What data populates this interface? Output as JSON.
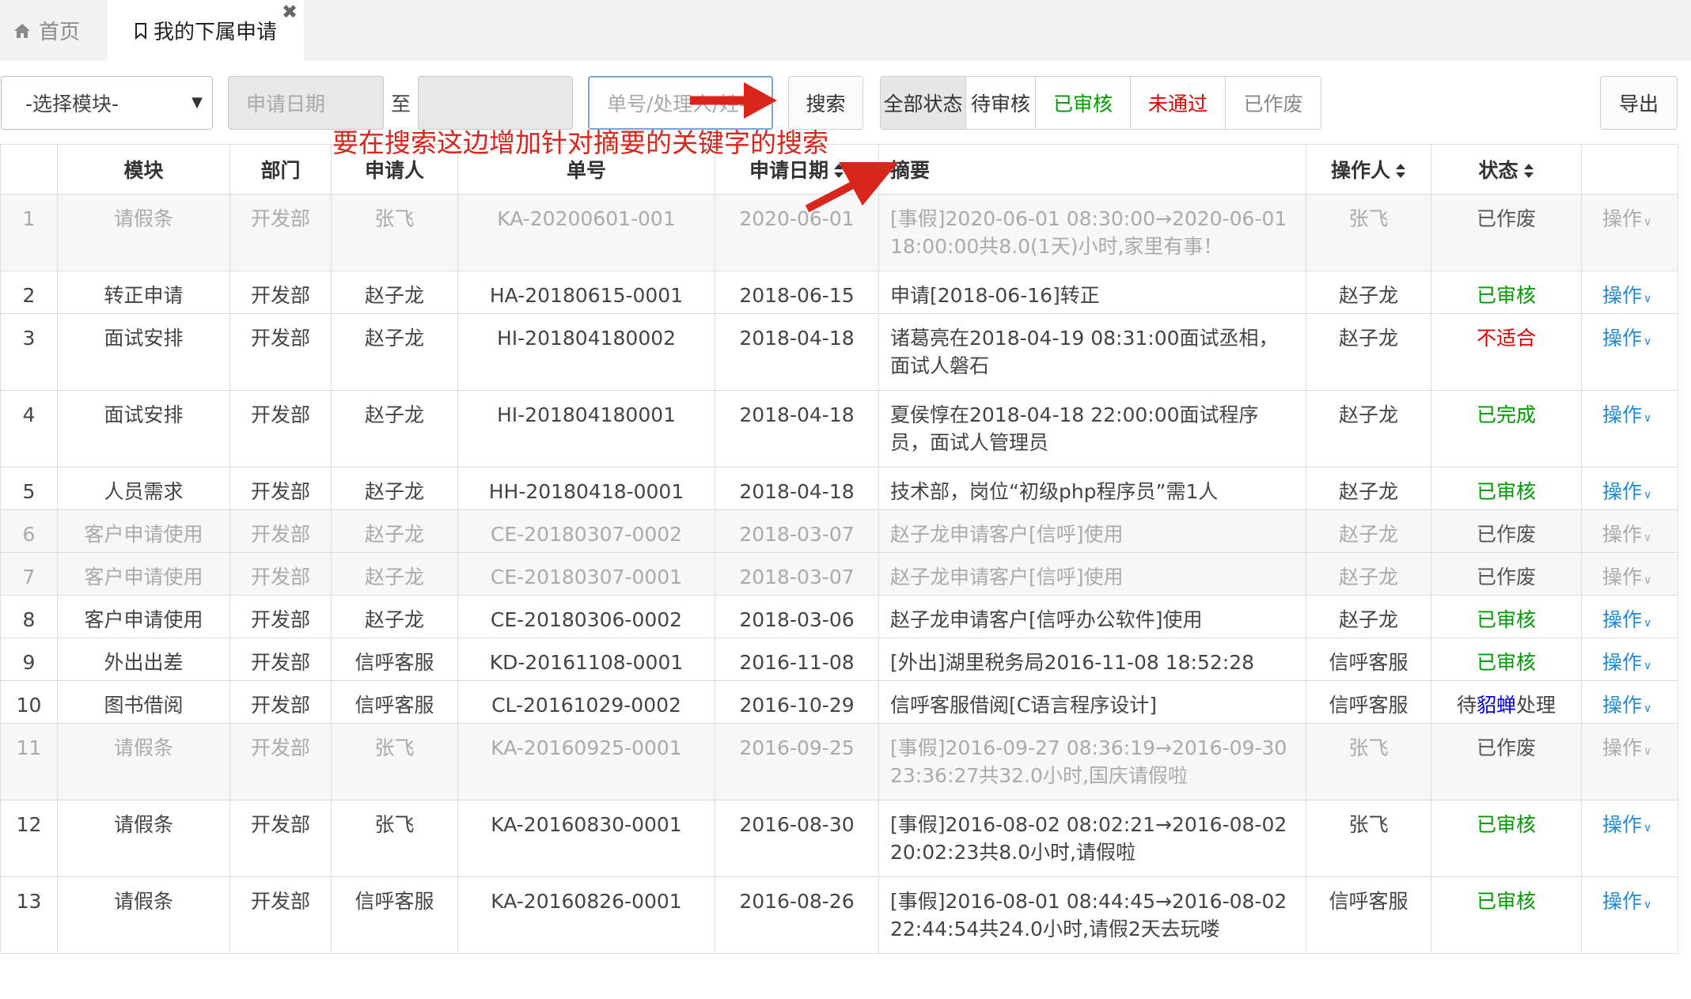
{
  "tabs": {
    "home_label": "首页",
    "active_label": "我的下属申请",
    "close_glyph": "✖"
  },
  "toolbar": {
    "module_select": "-选择模块-",
    "date_placeholder": "申请日期",
    "to_label": "至",
    "search_placeholder": "单号/处理人/姓名",
    "search_label": "搜索",
    "export_label": "导出",
    "status_filters": [
      {
        "label": "全部状态",
        "color": "#333333",
        "active": true
      },
      {
        "label": "待审核",
        "color": "#333333",
        "active": false
      },
      {
        "label": "已审核",
        "color": "#009900",
        "active": false
      },
      {
        "label": "未通过",
        "color": "#e00000",
        "active": false
      },
      {
        "label": "已作废",
        "color": "#888888",
        "active": false
      }
    ]
  },
  "annotation": {
    "text": "要在搜索这边增加针对摘要的关键字的搜索",
    "color": "#d9261c"
  },
  "table": {
    "headers": {
      "num": "",
      "module": "模块",
      "dept": "部门",
      "applicant": "申请人",
      "number": "单号",
      "date": "申请日期",
      "summary": "摘要",
      "operator": "操作人",
      "status": "状态",
      "op": ""
    },
    "action_label": "操作",
    "rows": [
      {
        "num": "1",
        "module": "请假条",
        "dept": "开发部",
        "applicant": "张飞",
        "number": "KA-20200601-001",
        "date": "2020-06-01",
        "summary": "[事假]2020-06-01 08:30:00→2020-06-01 18:00:00共8.0(1天)小时,家里有事！",
        "operator": "张飞",
        "status": "已作废",
        "status_color": "#555555",
        "dim": true
      },
      {
        "num": "2",
        "module": "转正申请",
        "dept": "开发部",
        "applicant": "赵子龙",
        "number": "HA-20180615-0001",
        "date": "2018-06-15",
        "summary": "申请[2018-06-16]转正",
        "operator": "赵子龙",
        "status": "已审核",
        "status_color": "#009900",
        "dim": false
      },
      {
        "num": "3",
        "module": "面试安排",
        "dept": "开发部",
        "applicant": "赵子龙",
        "number": "HI-201804180002",
        "date": "2018-04-18",
        "summary": "诸葛亮在2018-04-19 08:31:00面试丞相，面试人磐石",
        "operator": "赵子龙",
        "status": "不适合",
        "status_color": "#e00000",
        "dim": false
      },
      {
        "num": "4",
        "module": "面试安排",
        "dept": "开发部",
        "applicant": "赵子龙",
        "number": "HI-201804180001",
        "date": "2018-04-18",
        "summary": "夏侯惇在2018-04-18 22:00:00面试程序员，面试人管理员",
        "operator": "赵子龙",
        "status": "已完成",
        "status_color": "#009900",
        "dim": false
      },
      {
        "num": "5",
        "module": "人员需求",
        "dept": "开发部",
        "applicant": "赵子龙",
        "number": "HH-20180418-0001",
        "date": "2018-04-18",
        "summary": "技术部，岗位“初级php程序员”需1人",
        "operator": "赵子龙",
        "status": "已审核",
        "status_color": "#009900",
        "dim": false
      },
      {
        "num": "6",
        "module": "客户申请使用",
        "dept": "开发部",
        "applicant": "赵子龙",
        "number": "CE-20180307-0002",
        "date": "2018-03-07",
        "summary": "赵子龙申请客户[信呼]使用",
        "operator": "赵子龙",
        "status": "已作废",
        "status_color": "#555555",
        "dim": true
      },
      {
        "num": "7",
        "module": "客户申请使用",
        "dept": "开发部",
        "applicant": "赵子龙",
        "number": "CE-20180307-0001",
        "date": "2018-03-07",
        "summary": "赵子龙申请客户[信呼]使用",
        "operator": "赵子龙",
        "status": "已作废",
        "status_color": "#555555",
        "dim": true
      },
      {
        "num": "8",
        "module": "客户申请使用",
        "dept": "开发部",
        "applicant": "赵子龙",
        "number": "CE-20180306-0002",
        "date": "2018-03-06",
        "summary": "赵子龙申请客户[信呼办公软件]使用",
        "operator": "赵子龙",
        "status": "已审核",
        "status_color": "#009900",
        "dim": false
      },
      {
        "num": "9",
        "module": "外出出差",
        "dept": "开发部",
        "applicant": "信呼客服",
        "number": "KD-20161108-0001",
        "date": "2016-11-08",
        "summary": "[外出]湖里税务局2016-11-08 18:52:28",
        "operator": "信呼客服",
        "status": "已审核",
        "status_color": "#009900",
        "dim": false
      },
      {
        "num": "10",
        "module": "图书借阅",
        "dept": "开发部",
        "applicant": "信呼客服",
        "number": "CL-20161029-0002",
        "date": "2016-10-29",
        "summary": "信呼客服借阅[C语言程序设计]",
        "operator": "信呼客服",
        "status_pre": "待",
        "status_name": "貂蝉",
        "status_post": "处理",
        "status_color": "#444444",
        "dim": false
      },
      {
        "num": "11",
        "module": "请假条",
        "dept": "开发部",
        "applicant": "张飞",
        "number": "KA-20160925-0001",
        "date": "2016-09-25",
        "summary": "[事假]2016-09-27 08:36:19→2016-09-30 23:36:27共32.0小时,国庆请假啦",
        "operator": "张飞",
        "status": "已作废",
        "status_color": "#555555",
        "dim": true
      },
      {
        "num": "12",
        "module": "请假条",
        "dept": "开发部",
        "applicant": "张飞",
        "number": "KA-20160830-0001",
        "date": "2016-08-30",
        "summary": "[事假]2016-08-02 08:02:21→2016-08-02 20:02:23共8.0小时,请假啦",
        "operator": "张飞",
        "status": "已审核",
        "status_color": "#009900",
        "dim": false
      },
      {
        "num": "13",
        "module": "请假条",
        "dept": "开发部",
        "applicant": "信呼客服",
        "number": "KA-20160826-0001",
        "date": "2016-08-26",
        "summary": "[事假]2016-08-01 08:44:45→2016-08-02 22:44:54共24.0小时,请假2天去玩喽",
        "operator": "信呼客服",
        "status": "已审核",
        "status_color": "#009900",
        "dim": false
      }
    ]
  }
}
